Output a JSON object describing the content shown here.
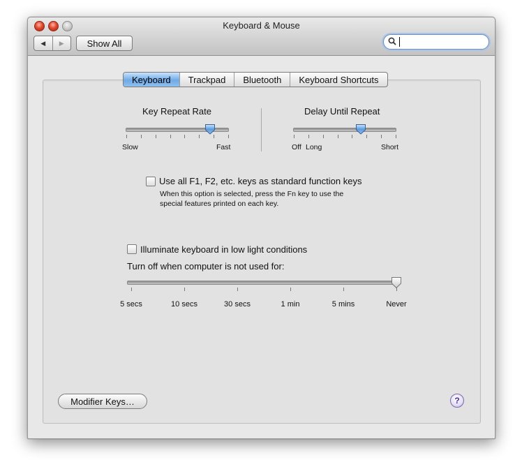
{
  "window": {
    "title": "Keyboard & Mouse"
  },
  "toolbar": {
    "back_icon": "◀",
    "forward_icon": "▶",
    "show_all_label": "Show All",
    "search_icon": "🔍",
    "search_value": ""
  },
  "tabs": [
    {
      "label": "Keyboard",
      "active": true
    },
    {
      "label": "Trackpad",
      "active": false
    },
    {
      "label": "Bluetooth",
      "active": false
    },
    {
      "label": "Keyboard Shortcuts",
      "active": false
    }
  ],
  "key_repeat": {
    "title": "Key Repeat Rate",
    "min_label": "Slow",
    "max_label": "Fast",
    "level": 0.82
  },
  "delay_repeat": {
    "title": "Delay Until Repeat",
    "off_label": "Off",
    "min_label": "Long",
    "max_label": "Short",
    "level": 0.66
  },
  "function_keys": {
    "label": "Use all F1, F2, etc. keys as standard function keys",
    "checked": false,
    "description_line1": "When this option is selected, press the Fn key to use the",
    "description_line2": "special features printed on each key."
  },
  "illuminate": {
    "label": "Illuminate keyboard in low light conditions",
    "checked": false,
    "turn_off_label": "Turn off when computer is not used for:",
    "stops": [
      "5 secs",
      "10 secs",
      "30 secs",
      "1 min",
      "5 mins",
      "Never"
    ],
    "selected": "Never"
  },
  "buttons": {
    "modifier_keys_label": "Modifier Keys…",
    "help_label": "?"
  },
  "colors": {
    "active_tab": "#6fa9e6",
    "close_button": "#e04a2f",
    "help_icon": "#4b2c9a"
  }
}
